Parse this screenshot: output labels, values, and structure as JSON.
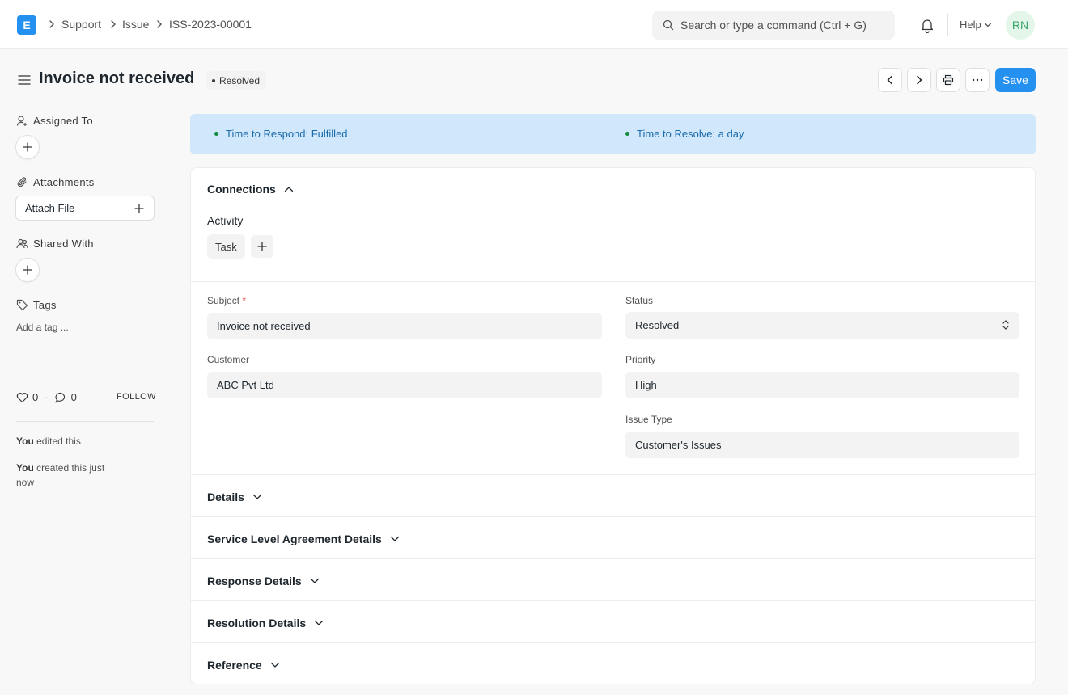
{
  "navbar": {
    "logo_letter": "E",
    "breadcrumbs": [
      "Support",
      "Issue",
      "ISS-2023-00001"
    ],
    "search_placeholder": "Search or type a command (Ctrl + G)",
    "help_label": "Help",
    "avatar_initials": "RN"
  },
  "page": {
    "title": "Invoice not received",
    "status": "Resolved",
    "save_label": "Save"
  },
  "sidebar": {
    "assigned_to_label": "Assigned To",
    "attachments_label": "Attachments",
    "attach_file_label": "Attach File",
    "shared_with_label": "Shared With",
    "tags_label": "Tags",
    "add_tag_label": "Add a tag ...",
    "likes_count": "0",
    "comments_count": "0",
    "follow_label": "FOLLOW",
    "activity": [
      {
        "actor": "You",
        "action": "edited this"
      },
      {
        "actor": "You",
        "action": "created this",
        "time": "just now"
      }
    ]
  },
  "sla": {
    "respond": "Time to Respond: Fulfilled",
    "resolve": "Time to Resolve: a day"
  },
  "form": {
    "connections_label": "Connections",
    "activity_label": "Activity",
    "task_label": "Task",
    "fields": {
      "subject_label": "Subject",
      "subject_value": "Invoice not received",
      "customer_label": "Customer",
      "customer_value": "ABC Pvt Ltd",
      "status_label": "Status",
      "status_value": "Resolved",
      "priority_label": "Priority",
      "priority_value": "High",
      "issue_type_label": "Issue Type",
      "issue_type_value": "Customer's Issues"
    },
    "sections": [
      "Details",
      "Service Level Agreement Details",
      "Response Details",
      "Resolution Details",
      "Reference"
    ]
  },
  "colors": {
    "primary": "#2490ef",
    "sla_banner": "#d0e7fc",
    "sla_dot": "#138a3f",
    "avatar_bg": "#e4f5e9"
  }
}
